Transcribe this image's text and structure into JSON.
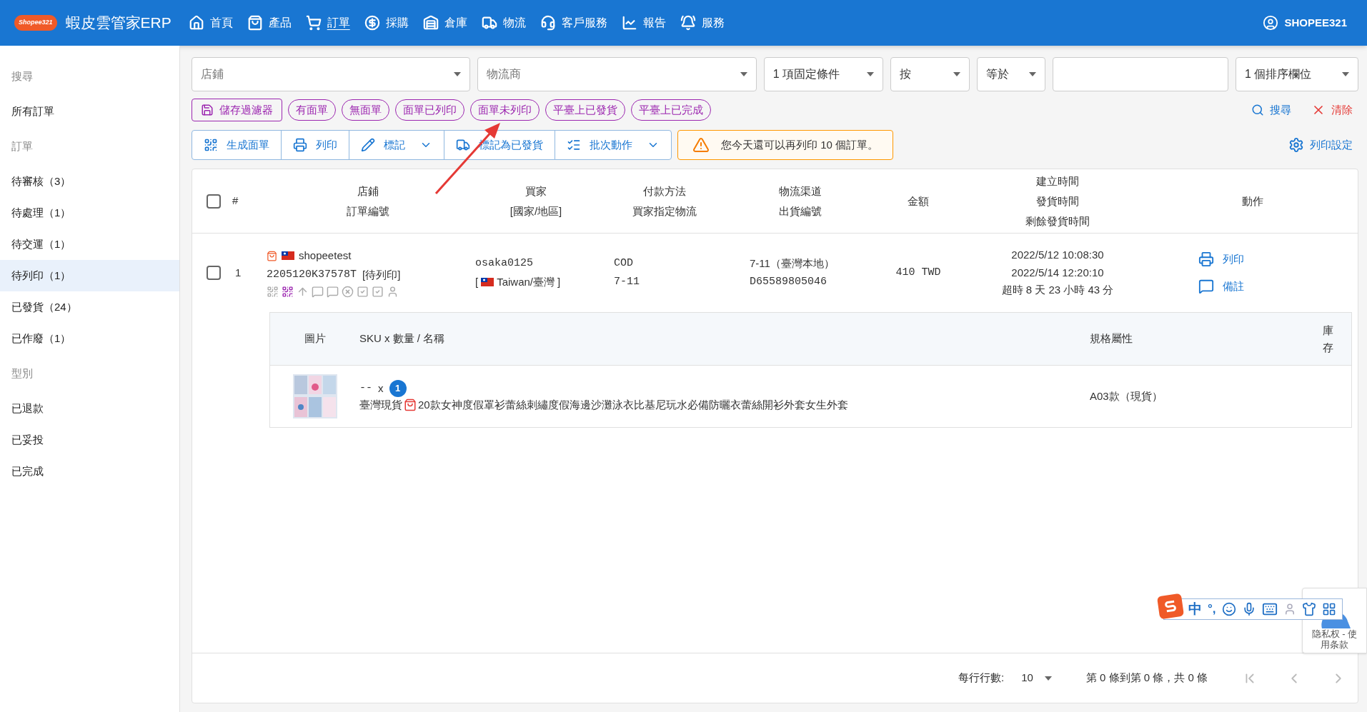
{
  "header": {
    "brand_badge": "Shopee321",
    "brand": "蝦皮雲管家ERP",
    "user": "SHOPEE321",
    "nav": [
      {
        "label": "首頁",
        "selected": false
      },
      {
        "label": "產品",
        "selected": false
      },
      {
        "label": "訂單",
        "selected": true
      },
      {
        "label": "採購",
        "selected": false
      },
      {
        "label": "倉庫",
        "selected": false
      },
      {
        "label": "物流",
        "selected": false
      },
      {
        "label": "客戶服務",
        "selected": false
      },
      {
        "label": "報告",
        "selected": false
      },
      {
        "label": "服務",
        "selected": false
      }
    ]
  },
  "sidebar": {
    "items": [
      {
        "kind": "heading",
        "label": "搜尋",
        "selected": false
      },
      {
        "kind": "link",
        "label": "所有訂單",
        "selected": false
      },
      {
        "kind": "heading",
        "label": "訂單",
        "selected": false
      },
      {
        "kind": "link",
        "label": "待審核（3）",
        "selected": false
      },
      {
        "kind": "link",
        "label": "待處理（1）",
        "selected": false
      },
      {
        "kind": "link",
        "label": "待交運（1）",
        "selected": false
      },
      {
        "kind": "link",
        "label": "待列印（1）",
        "selected": true
      },
      {
        "kind": "link",
        "label": "已發貨（24）",
        "selected": false
      },
      {
        "kind": "link",
        "label": "已作廢（1）",
        "selected": false
      },
      {
        "kind": "heading",
        "label": "型別",
        "selected": false
      },
      {
        "kind": "link",
        "label": "已退款",
        "selected": false
      },
      {
        "kind": "link",
        "label": "已妥投",
        "selected": false
      },
      {
        "kind": "link",
        "label": "已完成",
        "selected": false
      }
    ]
  },
  "filters": [
    {
      "kind": "select",
      "placeholder": "店鋪"
    },
    {
      "kind": "select",
      "placeholder": "物流商"
    },
    {
      "kind": "select",
      "value": "1 項固定條件"
    },
    {
      "kind": "select",
      "value": "按"
    },
    {
      "kind": "select",
      "value": "等於"
    },
    {
      "kind": "input"
    },
    {
      "kind": "select",
      "value": "1 個排序欄位"
    }
  ],
  "quick_filters": {
    "save": "儲存過濾器",
    "chips": [
      "有面單",
      "無面單",
      "面單已列印",
      "面單未列印",
      "平臺上已發貨",
      "平臺上已完成"
    ],
    "search": "搜尋",
    "clear": "清除"
  },
  "actions": {
    "buttons": [
      {
        "label": "生成面單",
        "dropdown": false
      },
      {
        "label": "列印",
        "dropdown": false
      },
      {
        "label": "標記",
        "dropdown": true
      },
      {
        "label": "標記為已發貨",
        "dropdown": false
      },
      {
        "label": "批次動作",
        "dropdown": true
      }
    ],
    "warning": "您今天還可以再列印 10 個訂單。",
    "print_settings": "列印設定"
  },
  "table": {
    "select_all_checked": false,
    "columns": [
      [
        "#"
      ],
      [
        "店鋪",
        "訂單編號"
      ],
      [
        "買家",
        "[國家/地區]"
      ],
      [
        "付款方法",
        "買家指定物流"
      ],
      [
        "物流渠道",
        "出貨編號"
      ],
      [
        "金額"
      ],
      [
        "建立時間",
        "發貨時間",
        "剩餘發貨時間"
      ],
      [
        "動作"
      ]
    ],
    "orders": [
      {
        "checked": false,
        "index": "1",
        "shop": "shopeetest",
        "order_no": "2205120K37578T",
        "status": "[待列印]",
        "buyer": "osaka0125",
        "region_open": "[",
        "region": "Taiwan/臺灣",
        "region_close": "]",
        "payment": "COD",
        "buyer_logistics": "7-11",
        "channel": "7-11（臺灣本地）",
        "tracking": "D65589805046",
        "amount": "410 TWD",
        "created": "2022/5/12 10:08:30",
        "shipped": "2022/5/14 12:20:10",
        "remaining": "超時 8 天 23 小時 43 分",
        "actions": [
          "列印",
          "備註"
        ],
        "items": {
          "columns": [
            "圖片",
            "SKU x 數量 / 名稱",
            "規格屬性",
            "庫存"
          ],
          "rows": [
            {
              "sku": "--",
              "x": "x",
              "quantity": "1",
              "name": "臺灣現貨",
              "name_rest": "20款女神度假罩衫蕾絲刺繡度假海邊沙灘泳衣比基尼玩水必備防曬衣蕾絲開衫外套女生外套",
              "spec": "A03款（現貨）"
            }
          ]
        }
      }
    ]
  },
  "pagination": {
    "rows_label": "每行行數:",
    "rows_per_page": "10",
    "range": "第 0 條到第 0 條，共 0 條"
  },
  "ime": {
    "label": "中",
    "punct": "°,"
  },
  "recaptcha": {
    "line1": "隐私权 - 使",
    "line2": "用条款"
  }
}
